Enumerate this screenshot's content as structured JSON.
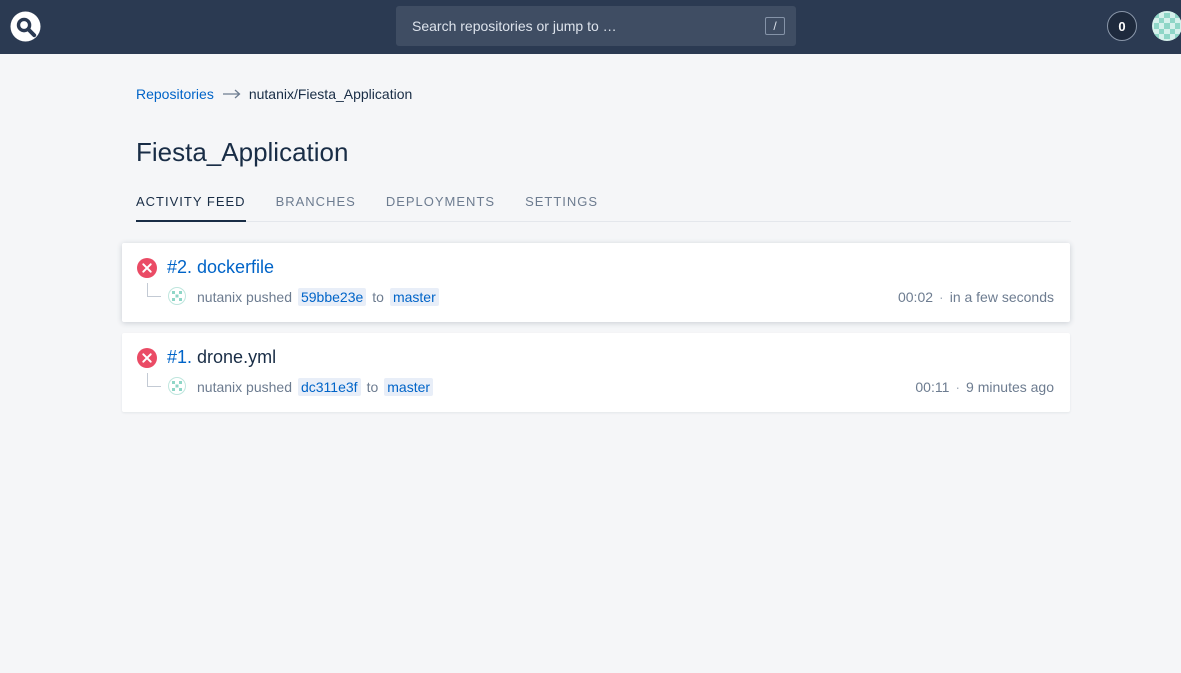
{
  "topbar": {
    "search_placeholder": "Search repositories or jump to …",
    "slash_key": "/",
    "counter": "0"
  },
  "breadcrumb": {
    "link": "Repositories",
    "current": "nutanix/Fiesta_Application"
  },
  "page": {
    "title": "Fiesta_Application"
  },
  "tabs": [
    {
      "label": "ACTIVITY FEED",
      "active": true
    },
    {
      "label": "BRANCHES",
      "active": false
    },
    {
      "label": "DEPLOYMENTS",
      "active": false
    },
    {
      "label": "SETTINGS",
      "active": false
    }
  ],
  "builds": [
    {
      "number": "#2.",
      "message": "dockerfile",
      "author": "nutanix",
      "action": "pushed",
      "commit": "59bbe23e",
      "to": "to",
      "branch": "master",
      "duration": "00:02",
      "time_ago": "in a few seconds",
      "status": "failure"
    },
    {
      "number": "#1.",
      "message": "drone.yml",
      "author": "nutanix",
      "action": "pushed",
      "commit": "dc311e3f",
      "to": "to",
      "branch": "master",
      "duration": "00:11",
      "time_ago": "9 minutes ago",
      "status": "failure"
    }
  ],
  "colors": {
    "topbar": "#2b3a52",
    "link": "#0064c8",
    "failure": "#ea4b65",
    "text": "#192d46",
    "muted": "#6d7c90"
  },
  "icons": {
    "logo": "drone-logo-icon",
    "status": "failure-x-icon",
    "avatar": "identicon-avatar"
  }
}
